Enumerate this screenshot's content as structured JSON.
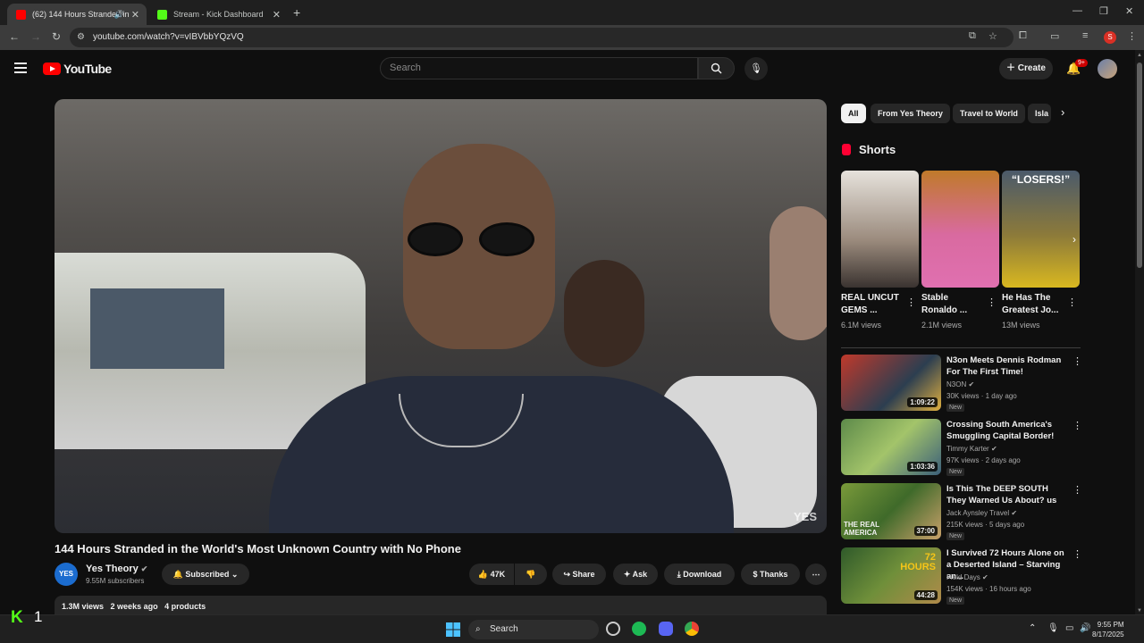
{
  "browser": {
    "tabs": [
      {
        "label": "(62) 144 Hours Stranded in",
        "active": true
      },
      {
        "label": "Stream - Kick Dashboard",
        "active": false
      }
    ],
    "url": "youtube.com/watch?v=vIBVbbYQzVQ"
  },
  "header": {
    "logo": "YouTube",
    "search_placeholder": "Search",
    "create_label": "Create",
    "notifications_badge": "9+"
  },
  "video": {
    "watermark": "YES",
    "title": "144 Hours Stranded in the World's Most Unknown Country with No Phone",
    "channel": {
      "name": "Yes Theory",
      "avatar_text": "YES",
      "subscribers": "9.55M subscribers"
    },
    "subscribed_label": "Subscribed",
    "likes": "47K",
    "actions": {
      "share": "Share",
      "ask": "Ask",
      "download": "Download",
      "thanks": "Thanks"
    },
    "meta": {
      "views": "1.3M views",
      "age": "2 weeks ago",
      "products": "4 products"
    }
  },
  "chips": [
    "All",
    "From Yes Theory",
    "Travel to World",
    "Isla"
  ],
  "shorts": {
    "heading": "Shorts",
    "items": [
      {
        "title": "REAL UNCUT GEMS ...",
        "views": "6.1M views",
        "caption": ""
      },
      {
        "title": "Stable Ronaldo ...",
        "views": "2.1M views",
        "caption": ""
      },
      {
        "title": "He Has The Greatest Jo...",
        "views": "13M views",
        "caption": "“LOSERS!”"
      }
    ]
  },
  "recommendations": [
    {
      "title": "N3on Meets Dennis Rodman For The First Time!",
      "channel": "N3ON",
      "verified": true,
      "views": "30K views",
      "age": "1 day ago",
      "duration": "1:09:22",
      "badge": "New"
    },
    {
      "title": "Crossing South America's Smuggling Capital Border!",
      "channel": "Timmy Karter",
      "verified": true,
      "views": "97K views",
      "age": "2 days ago",
      "duration": "1:03:36",
      "badge": "New"
    },
    {
      "title": "Is This The DEEP SOUTH They Warned Us About? us",
      "channel": "Jack Aynsley Travel",
      "verified": true,
      "views": "215K views",
      "age": "5 days ago",
      "duration": "37:00",
      "badge": "New",
      "thumb_text": "THE REAL AMERICA"
    },
    {
      "title": "I Survived 72 Hours Alone on a Deserted Island – Starving an...",
      "channel": "Field Days",
      "verified": true,
      "views": "154K views",
      "age": "16 hours ago",
      "duration": "44:28",
      "badge": "New",
      "thumb_text": "72 HOURS"
    }
  ],
  "taskbar": {
    "kick_count": "1",
    "search_label": "Search",
    "time": "9:55 PM",
    "date": "8/17/2025"
  },
  "colors": {
    "youtube_red": "#ff0000",
    "kick_green": "#53fc18",
    "background": "#0f0f0f"
  }
}
